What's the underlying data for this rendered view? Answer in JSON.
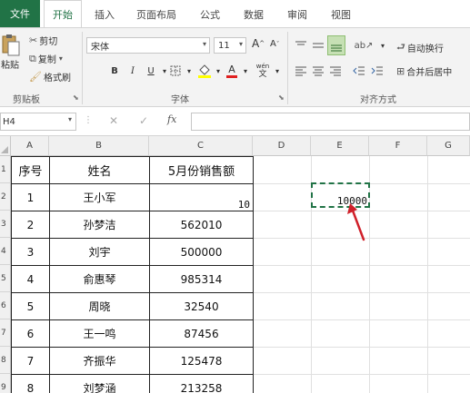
{
  "ribbon_tabs": {
    "file": "文件",
    "home": "开始",
    "insert": "插入",
    "page_layout": "页面布局",
    "formulas": "公式",
    "data": "数据",
    "review": "审阅",
    "view": "视图"
  },
  "clipboard": {
    "paste": "粘贴",
    "cut": "剪切",
    "copy": "复制",
    "format_painter": "格式刷",
    "label": "剪贴板"
  },
  "font": {
    "name": "宋体",
    "size": "11",
    "grow": "A",
    "shrink": "A",
    "bold": "B",
    "italic": "I",
    "underline": "U",
    "font_color_glyph": "A",
    "phonetic_top": "wén",
    "phonetic_bottom": "文",
    "label": "字体"
  },
  "alignment": {
    "wrap_text": "自动换行",
    "merge_center": "合并后居中",
    "label": "对齐方式"
  },
  "formula_bar": {
    "name_box": "H4",
    "fx": "fx"
  },
  "columns": [
    "A",
    "B",
    "C",
    "D",
    "E",
    "F",
    "G"
  ],
  "rows": [
    "1",
    "2",
    "3",
    "4",
    "5",
    "6",
    "7",
    "8",
    "9"
  ],
  "table": {
    "headers": [
      "序号",
      "姓名",
      "5月份销售额"
    ],
    "rows": [
      [
        "1",
        "王小军",
        ""
      ],
      [
        "2",
        "孙梦洁",
        "562010"
      ],
      [
        "3",
        "刘宇",
        "500000"
      ],
      [
        "4",
        "俞惠琴",
        "985314"
      ],
      [
        "5",
        "周晓",
        "32540"
      ],
      [
        "6",
        "王一鸣",
        "87456"
      ],
      [
        "7",
        "齐振华",
        "125478"
      ],
      [
        "8",
        "刘梦涵",
        "213258"
      ]
    ],
    "c2_value": "10",
    "e2_value": "10000"
  },
  "colors": {
    "accent": "#217346",
    "arrow": "#d0202a"
  }
}
